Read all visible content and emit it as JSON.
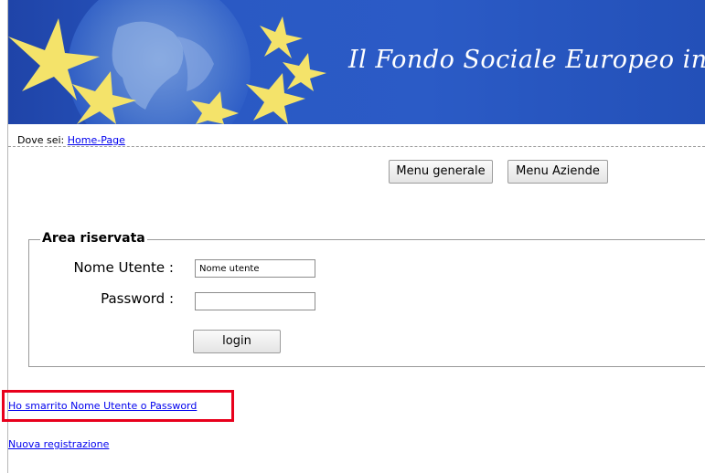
{
  "banner": {
    "title": "Il Fondo Sociale Europeo in Trentino"
  },
  "breadcrumb": {
    "label": "Dove sei:",
    "link": "Home-Page"
  },
  "menu": {
    "general": "Menu generale",
    "companies": "Menu Aziende"
  },
  "login_form": {
    "legend": "Area riservata",
    "username_label": "Nome Utente :",
    "username_value": "Nome utente",
    "password_label": "Password :",
    "password_value": "",
    "submit": "login"
  },
  "links": {
    "forgot": "Ho smarrito Nome Utente o Password",
    "register": "Nuova registrazione"
  },
  "colors": {
    "banner_blue": "#2b5bc6",
    "star_yellow": "#f4e36a",
    "highlight_red": "#e8001c",
    "link_blue": "#0000ee"
  }
}
